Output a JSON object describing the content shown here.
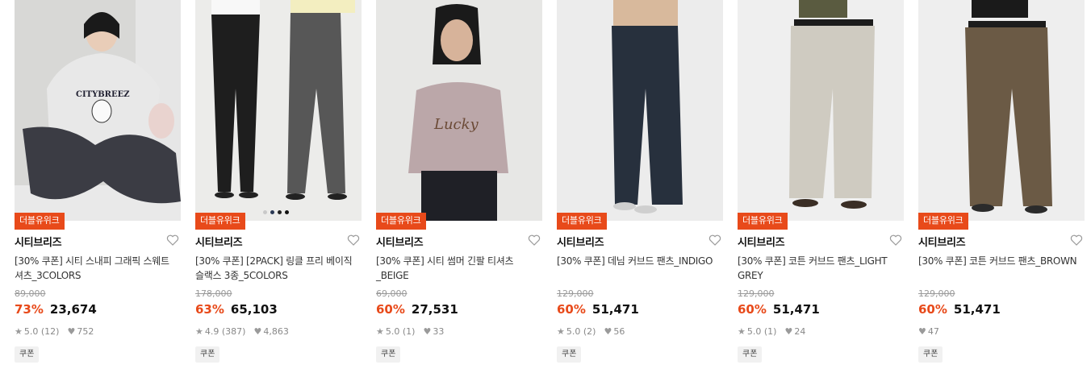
{
  "products": [
    {
      "badge": "더블유위크",
      "brand": "시티브리즈",
      "title": "[30% 쿠폰] 시티 스내피 그래픽 스웨트 셔츠_3COLORS",
      "original_price": "89,000",
      "discount": "73%",
      "price": "23,674",
      "rating": "5.0",
      "review_count": "(12)",
      "likes": "752",
      "coupon": "쿠폰",
      "image_desc": "model-sweatshirt"
    },
    {
      "badge": "더블유위크",
      "brand": "시티브리즈",
      "title": "[30% 쿠폰] [2PACK] 링클 프리 베이직 슬랙스 3종_5COLORS",
      "original_price": "178,000",
      "discount": "63%",
      "price": "65,103",
      "rating": "4.9",
      "review_count": "(387)",
      "likes": "4,863",
      "coupon": "쿠폰",
      "swatches": [
        "#c9c9c9",
        "#2b3a55",
        "#222222",
        "#111111"
      ]
    },
    {
      "badge": "더블유위크",
      "brand": "시티브리즈",
      "title": "[30% 쿠폰] 시티 썸머 긴팔 티셔츠_BEIGE",
      "original_price": "69,000",
      "discount": "60%",
      "price": "27,531",
      "rating": "5.0",
      "review_count": "(1)",
      "likes": "33",
      "coupon": "쿠폰"
    },
    {
      "badge": "더블유위크",
      "brand": "시티브리즈",
      "title": "[30% 쿠폰] 데님 커브드 팬츠_INDIGO",
      "original_price": "129,000",
      "discount": "60%",
      "price": "51,471",
      "rating": "5.0",
      "review_count": "(2)",
      "likes": "56",
      "coupon": "쿠폰"
    },
    {
      "badge": "더블유위크",
      "brand": "시티브리즈",
      "title": "[30% 쿠폰] 코튼 커브드 팬츠_LIGHT GREY",
      "original_price": "129,000",
      "discount": "60%",
      "price": "51,471",
      "rating": "5.0",
      "review_count": "(1)",
      "likes": "24",
      "coupon": "쿠폰"
    },
    {
      "badge": "더블유위크",
      "brand": "시티브리즈",
      "title": "[30% 쿠폰] 코튼 커브드 팬츠_BROWN",
      "original_price": "129,000",
      "discount": "60%",
      "price": "51,471",
      "rating": "",
      "review_count": "",
      "likes": "47",
      "coupon": "쿠폰"
    }
  ],
  "colors": {
    "accent": "#e84a1a",
    "muted": "#888888"
  },
  "icons": {
    "wishlist": "heart-outline-icon",
    "rating": "star-icon",
    "likes": "heart-icon"
  }
}
